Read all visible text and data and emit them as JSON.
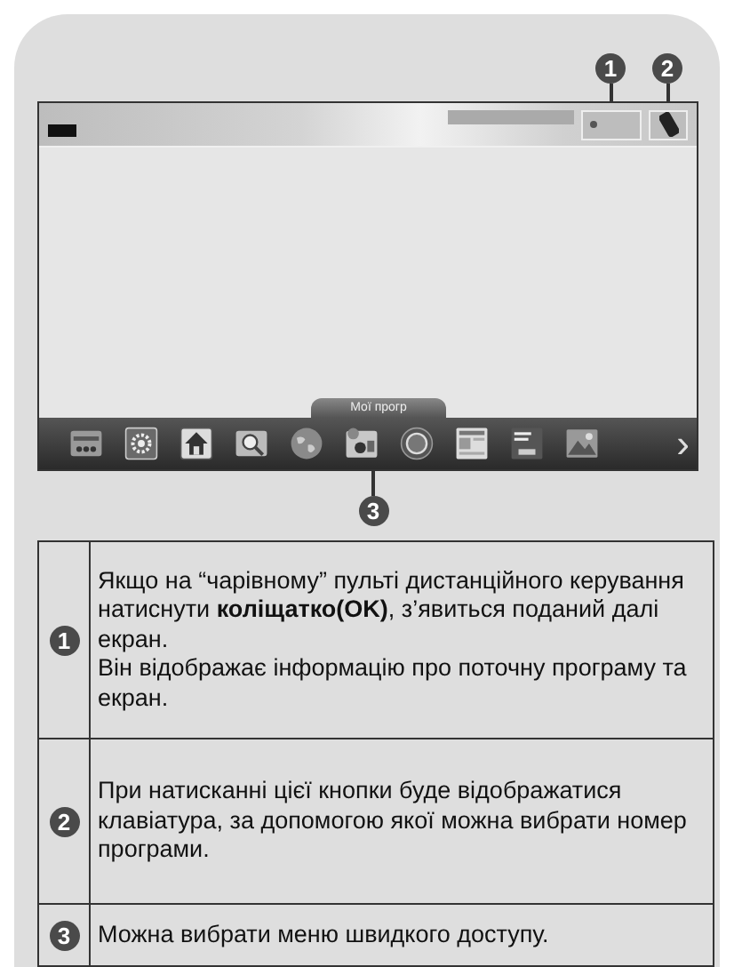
{
  "callouts": [
    {
      "number": "1"
    },
    {
      "number": "2"
    }
  ],
  "screen": {
    "dock": {
      "tab_label": "Мої прогр",
      "apps": [
        {
          "kind": "input"
        },
        {
          "kind": "settings"
        },
        {
          "kind": "home"
        },
        {
          "kind": "search"
        },
        {
          "kind": "globe"
        },
        {
          "kind": "media"
        },
        {
          "kind": "disc"
        },
        {
          "kind": "news"
        },
        {
          "kind": "guide"
        },
        {
          "kind": "photo"
        }
      ],
      "more": "›"
    }
  },
  "bottom_callout": {
    "number": "3"
  },
  "table": {
    "rows": [
      {
        "marker": "1",
        "paragraphs": [
          "Якщо на “чарівному” пульті дистанційного керування натиснути **коліщатко(OK)**, з’явиться поданий далі екран.",
          "Він відображає інформацію про поточну програму та екран."
        ]
      },
      {
        "marker": "2",
        "paragraphs": [
          "При натисканні цієї кнопки буде відображатися клавіатура, за допомогою якої можна вибрати номер програми."
        ]
      },
      {
        "marker": "3",
        "paragraphs": [
          "Можна вибрати меню швидкого доступу."
        ]
      }
    ]
  }
}
